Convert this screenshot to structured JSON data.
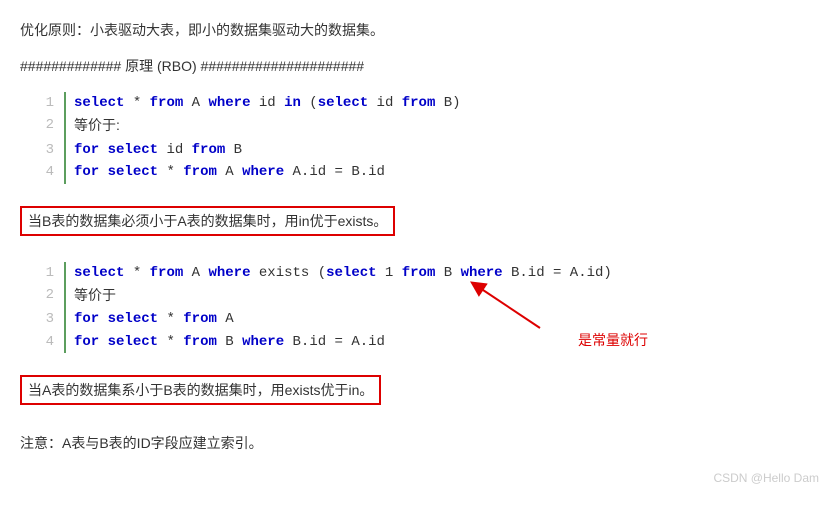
{
  "intro": "优化原则：小表驱动大表，即小的数据集驱动大的数据集。",
  "divider": "############# 原理 (RBO) #####################",
  "code1": {
    "lines": [
      {
        "num": "1",
        "html": "<span class='kw'>select</span> * <span class='kw'>from</span> A <span class='kw'>where</span> id <span class='kw'>in</span> (<span class='kw'>select</span> id <span class='kw'>from</span> B)"
      },
      {
        "num": "2",
        "html": "<span class='equiv'>等价于:</span>"
      },
      {
        "num": "3",
        "html": "<span class='kw'>for</span> <span class='kw'>select</span> id <span class='kw'>from</span> B"
      },
      {
        "num": "4",
        "html": "<span class='kw'>for</span> <span class='kw'>select</span> * <span class='kw'>from</span> A <span class='kw'>where</span> A.id = B.id"
      }
    ]
  },
  "rule1": "当B表的数据集必须小于A表的数据集时，用in优于exists。",
  "code2": {
    "lines": [
      {
        "num": "1",
        "html": "<span class='kw'>select</span> * <span class='kw'>from</span> A <span class='kw'>where</span> exists (<span class='kw'>select</span> 1 <span class='kw'>from</span> B <span class='kw'>where</span> B.id = A.id)"
      },
      {
        "num": "2",
        "html": "<span class='equiv'>等价于</span>"
      },
      {
        "num": "3",
        "html": "<span class='kw'>for</span> <span class='kw'>select</span> * <span class='kw'>from</span> A"
      },
      {
        "num": "4",
        "html": "<span class='kw'>for</span> <span class='kw'>select</span> * <span class='kw'>from</span> B <span class='kw'>where</span> B.id = A.id"
      }
    ]
  },
  "rule2": "当A表的数据集系小于B表的数据集时，用exists优于in。",
  "note": "注意：A表与B表的ID字段应建立索引。",
  "annot": "是常量就行",
  "watermark": "CSDN @Hello Dam"
}
